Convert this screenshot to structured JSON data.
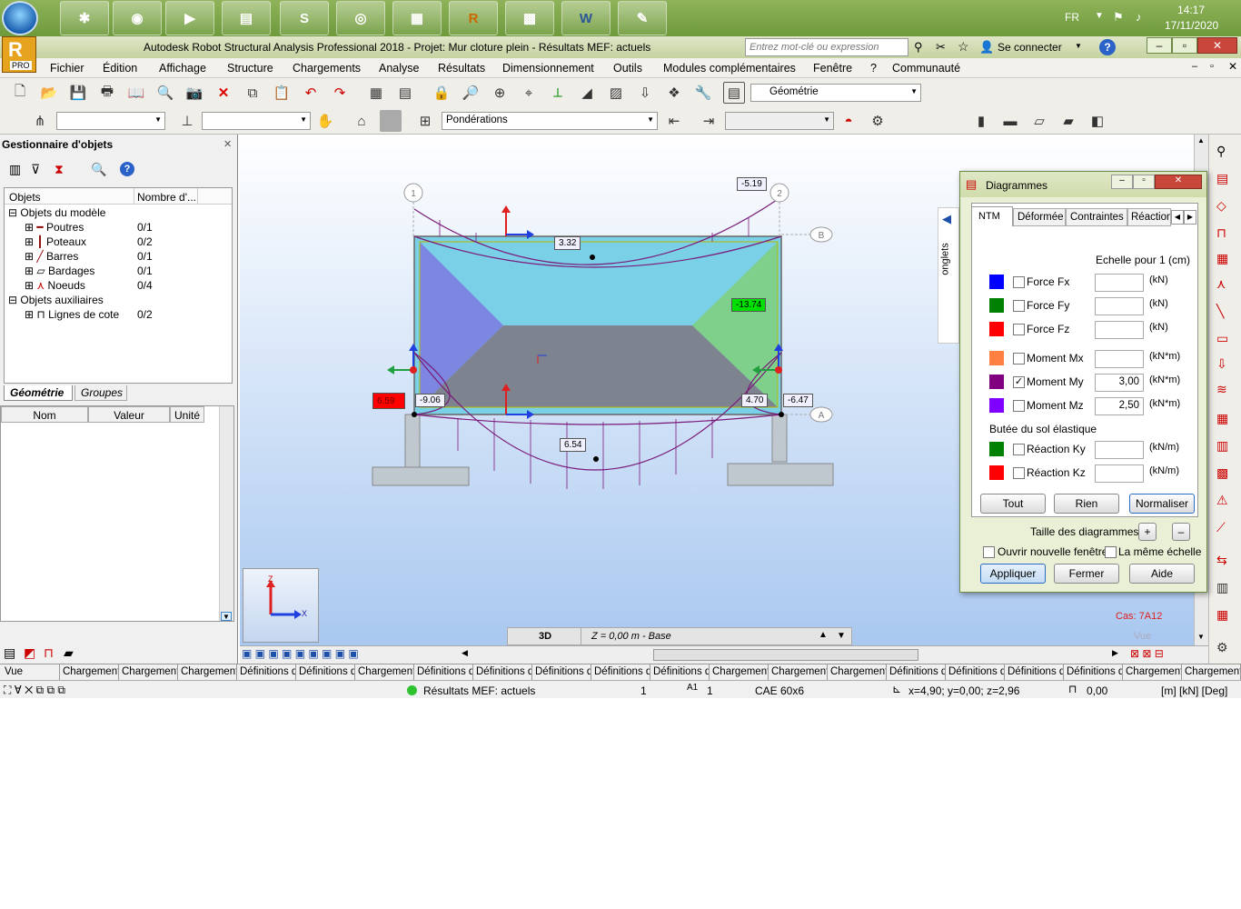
{
  "taskbar": {
    "apps": [
      {
        "icon": "start-orb-icon"
      },
      {
        "icon": "antivirus-icon"
      },
      {
        "icon": "chrome-icon"
      },
      {
        "icon": "media-player-icon"
      },
      {
        "icon": "file-explorer-icon"
      },
      {
        "icon": "skype-icon",
        "letter": "S"
      },
      {
        "icon": "disc-icon"
      },
      {
        "icon": "winrar-icon"
      },
      {
        "icon": "robot-icon",
        "letter": "R"
      },
      {
        "icon": "calculator-icon"
      },
      {
        "icon": "word-icon",
        "letter": "W"
      },
      {
        "icon": "paint-icon"
      }
    ],
    "lang": "FR",
    "time": "14:17",
    "date": "17/11/2020"
  },
  "titlebar": {
    "app_badge": "R",
    "app_badge_sub": "PRO",
    "title": "Autodesk Robot Structural Analysis Professional 2018 - Projet: Mur cloture plein - Résultats MEF: actuels",
    "search_placeholder": "Entrez mot-clé ou expression",
    "signin": "Se connecter"
  },
  "menu": [
    "Fichier",
    "Édition",
    "Affichage",
    "Structure",
    "Chargements",
    "Analyse",
    "Résultats",
    "Dimensionnement",
    "Outils",
    "Modules complémentaires",
    "Fenêtre",
    "?",
    "Communauté"
  ],
  "toolbar": {
    "view_combo": "Géométrie",
    "ponderations_combo": "Pondérations"
  },
  "object_manager": {
    "title": "Gestionnaire d'objets",
    "columns": [
      "Objets",
      "Nombre d'..."
    ],
    "groups": [
      {
        "label": "Objets du modèle",
        "items": [
          {
            "label": "Poutres",
            "count": "0/1"
          },
          {
            "label": "Poteaux",
            "count": "0/2"
          },
          {
            "label": "Barres",
            "count": "0/1"
          },
          {
            "label": "Bardages",
            "count": "0/1"
          },
          {
            "label": "Noeuds",
            "count": "0/4"
          }
        ]
      },
      {
        "label": "Objets auxiliaires",
        "items": [
          {
            "label": "Lignes de cote",
            "count": "0/2"
          }
        ]
      }
    ],
    "tabs": [
      "Géométrie",
      "Groupes"
    ],
    "props_columns": [
      "Nom",
      "Valeur",
      "Unité"
    ]
  },
  "viewport": {
    "labels": {
      "top_right": "-5.19",
      "top_mid": "3.32",
      "right_mid": "-13.74",
      "left_red": "6.59",
      "left_bottom": "-9.06",
      "right_bottom1": "4.70",
      "right_bottom2": "-6.47",
      "bottom_mid": "6.54"
    },
    "axis_markers": {
      "one": "1",
      "two": "2",
      "b": "B",
      "a": "A"
    },
    "axes": {
      "z": "Z",
      "x": "X"
    },
    "onglets": "onglets",
    "case": "Cas: 7A12",
    "vue": "Vue",
    "mode": "3D",
    "level": "Z = 0,00 m - Base"
  },
  "diagrammes": {
    "title": "Diagrammes",
    "tabs": [
      "NTM",
      "Déformée",
      "Contraintes",
      "Réaction"
    ],
    "scale_label": "Echelle pour 1  (cm)",
    "rows": [
      {
        "label": "Force Fx",
        "color": "#0000ff",
        "checked": false,
        "value": "",
        "unit": "(kN)"
      },
      {
        "label": "Force Fy",
        "color": "#008000",
        "checked": false,
        "value": "",
        "unit": "(kN)"
      },
      {
        "label": "Force Fz",
        "color": "#ff0000",
        "checked": false,
        "value": "",
        "unit": "(kN)"
      },
      {
        "label": "Moment Mx",
        "color": "#ff8040",
        "checked": false,
        "value": "",
        "unit": "(kN*m)"
      },
      {
        "label": "Moment My",
        "color": "#800080",
        "checked": true,
        "value": "3,00",
        "unit": "(kN*m)"
      },
      {
        "label": "Moment Mz",
        "color": "#8000ff",
        "checked": false,
        "value": "2,50",
        "unit": "(kN*m)"
      }
    ],
    "soil_label": "Butée du sol élastique",
    "soil_rows": [
      {
        "label": "Réaction Ky",
        "color": "#008000",
        "checked": false,
        "value": "",
        "unit": "(kN/m)"
      },
      {
        "label": "Réaction Kz",
        "color": "#ff0000",
        "checked": false,
        "value": "",
        "unit": "(kN/m)"
      }
    ],
    "btn_all": "Tout",
    "btn_none": "Rien",
    "btn_normalize": "Normaliser",
    "size_label": "Taille des diagrammes:",
    "new_window": "Ouvrir nouvelle fenêtre",
    "same_scale": "La même échelle",
    "btn_apply": "Appliquer",
    "btn_close": "Fermer",
    "btn_help": "Aide"
  },
  "bottom_tabs": [
    "Vue",
    "Chargement",
    "Chargement",
    "Chargement",
    "Définitions d",
    "Définitions d",
    "Chargement",
    "Définitions d",
    "Définitions d",
    "Définitions d",
    "Définitions d",
    "Définitions d",
    "Chargement",
    "Chargement",
    "Chargement",
    "Définitions d",
    "Définitions d",
    "Définitions d",
    "Définitions d",
    "Chargement",
    "Chargement"
  ],
  "status": {
    "results": "Résultats MEF: actuels",
    "n1": "1",
    "n2": "1",
    "section": "CAE 60x6",
    "coords": "x=4,90; y=0,00; z=2,96",
    "angle": "0,00",
    "units": "[m] [kN] [Deg]"
  }
}
